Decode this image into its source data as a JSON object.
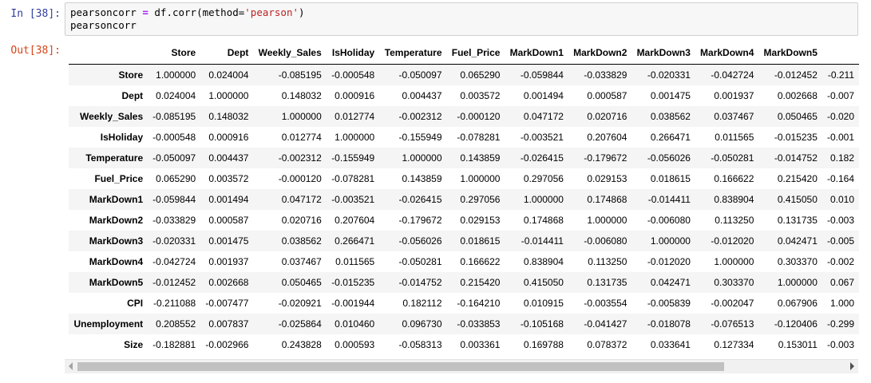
{
  "cell": {
    "in_prompt": "In [38]:",
    "out_prompt": "Out[38]:",
    "code": {
      "line1_var": "pearsoncorr",
      "line1_eq": "=",
      "line1_call": "df.corr(method=",
      "line1_str": "'pearson'",
      "line1_close": ")",
      "line2": "pearsoncorr"
    }
  },
  "table": {
    "columns": [
      "Store",
      "Dept",
      "Weekly_Sales",
      "IsHoliday",
      "Temperature",
      "Fuel_Price",
      "MarkDown1",
      "MarkDown2",
      "MarkDown3",
      "MarkDown4",
      "MarkDown5",
      ""
    ],
    "rows": [
      {
        "label": "Store",
        "values": [
          "1.000000",
          "0.024004",
          "-0.085195",
          "-0.000548",
          "-0.050097",
          "0.065290",
          "-0.059844",
          "-0.033829",
          "-0.020331",
          "-0.042724",
          "-0.012452",
          "-0.211"
        ]
      },
      {
        "label": "Dept",
        "values": [
          "0.024004",
          "1.000000",
          "0.148032",
          "0.000916",
          "0.004437",
          "0.003572",
          "0.001494",
          "0.000587",
          "0.001475",
          "0.001937",
          "0.002668",
          "-0.007"
        ]
      },
      {
        "label": "Weekly_Sales",
        "values": [
          "-0.085195",
          "0.148032",
          "1.000000",
          "0.012774",
          "-0.002312",
          "-0.000120",
          "0.047172",
          "0.020716",
          "0.038562",
          "0.037467",
          "0.050465",
          "-0.020"
        ]
      },
      {
        "label": "IsHoliday",
        "values": [
          "-0.000548",
          "0.000916",
          "0.012774",
          "1.000000",
          "-0.155949",
          "-0.078281",
          "-0.003521",
          "0.207604",
          "0.266471",
          "0.011565",
          "-0.015235",
          "-0.001"
        ]
      },
      {
        "label": "Temperature",
        "values": [
          "-0.050097",
          "0.004437",
          "-0.002312",
          "-0.155949",
          "1.000000",
          "0.143859",
          "-0.026415",
          "-0.179672",
          "-0.056026",
          "-0.050281",
          "-0.014752",
          "0.182"
        ]
      },
      {
        "label": "Fuel_Price",
        "values": [
          "0.065290",
          "0.003572",
          "-0.000120",
          "-0.078281",
          "0.143859",
          "1.000000",
          "0.297056",
          "0.029153",
          "0.018615",
          "0.166622",
          "0.215420",
          "-0.164"
        ]
      },
      {
        "label": "MarkDown1",
        "values": [
          "-0.059844",
          "0.001494",
          "0.047172",
          "-0.003521",
          "-0.026415",
          "0.297056",
          "1.000000",
          "0.174868",
          "-0.014411",
          "0.838904",
          "0.415050",
          "0.010"
        ]
      },
      {
        "label": "MarkDown2",
        "values": [
          "-0.033829",
          "0.000587",
          "0.020716",
          "0.207604",
          "-0.179672",
          "0.029153",
          "0.174868",
          "1.000000",
          "-0.006080",
          "0.113250",
          "0.131735",
          "-0.003"
        ]
      },
      {
        "label": "MarkDown3",
        "values": [
          "-0.020331",
          "0.001475",
          "0.038562",
          "0.266471",
          "-0.056026",
          "0.018615",
          "-0.014411",
          "-0.006080",
          "1.000000",
          "-0.012020",
          "0.042471",
          "-0.005"
        ]
      },
      {
        "label": "MarkDown4",
        "values": [
          "-0.042724",
          "0.001937",
          "0.037467",
          "0.011565",
          "-0.050281",
          "0.166622",
          "0.838904",
          "0.113250",
          "-0.012020",
          "1.000000",
          "0.303370",
          "-0.002"
        ]
      },
      {
        "label": "MarkDown5",
        "values": [
          "-0.012452",
          "0.002668",
          "0.050465",
          "-0.015235",
          "-0.014752",
          "0.215420",
          "0.415050",
          "0.131735",
          "0.042471",
          "0.303370",
          "1.000000",
          "0.067"
        ]
      },
      {
        "label": "CPI",
        "values": [
          "-0.211088",
          "-0.007477",
          "-0.020921",
          "-0.001944",
          "0.182112",
          "-0.164210",
          "0.010915",
          "-0.003554",
          "-0.005839",
          "-0.002047",
          "0.067906",
          "1.000"
        ]
      },
      {
        "label": "Unemployment",
        "values": [
          "0.208552",
          "0.007837",
          "-0.025864",
          "0.010460",
          "0.096730",
          "-0.033853",
          "-0.105168",
          "-0.041427",
          "-0.018078",
          "-0.076513",
          "-0.120406",
          "-0.299"
        ]
      },
      {
        "label": "Size",
        "values": [
          "-0.182881",
          "-0.002966",
          "0.243828",
          "0.000593",
          "-0.058313",
          "0.003361",
          "0.169788",
          "0.078372",
          "0.033641",
          "0.127334",
          "0.153011",
          "-0.003"
        ]
      }
    ]
  },
  "colors": {
    "in_prompt": "#303f9f",
    "out_prompt": "#d84315",
    "input_bg": "#f7f7f7",
    "row_stripe": "#f5f5f5"
  },
  "icons": {
    "scroll_left": "triangle-left-icon",
    "scroll_right": "triangle-right-icon"
  }
}
